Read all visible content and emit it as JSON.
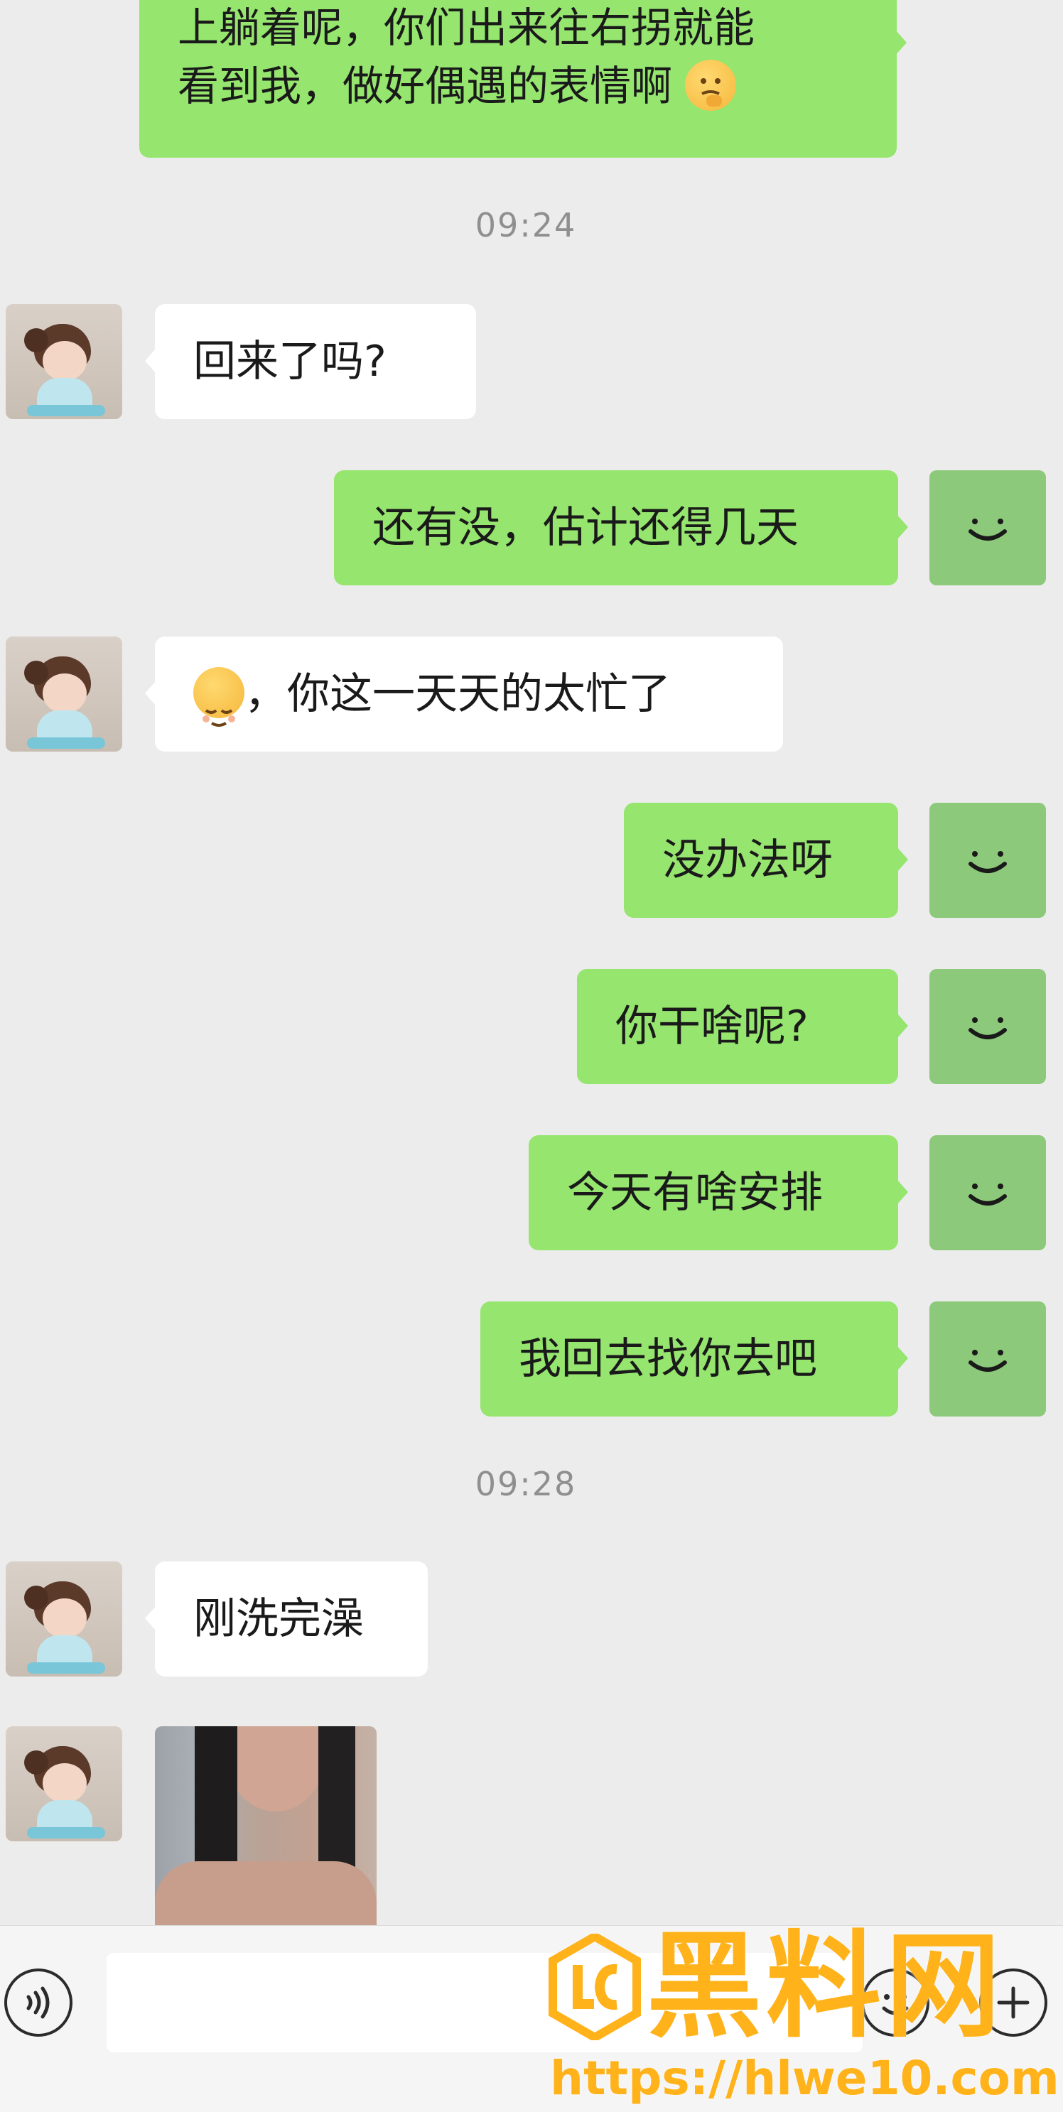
{
  "colors": {
    "background": "#ececec",
    "incoming_bubble": "#ffffff",
    "outgoing_bubble": "#95e56f",
    "timestamp": "#8f8f8f",
    "watermark": "#ffb21a"
  },
  "messages": {
    "top_partial": {
      "line1": "上躺着呢，你们出来往右拐就能",
      "line2": "看到我，做好偶遇的表情啊",
      "emoji": "thinking-face-emoji"
    },
    "time1": "09:24",
    "m1": "回来了吗?",
    "m2": "还有没，估计还得几天",
    "m3": "，你这一天天的太忙了",
    "m3_emoji": "relieved-face-emoji",
    "m4": "没办法呀",
    "m5": "你干啥呢?",
    "m6": "今天有啥安排",
    "m7": "我回去找你去吧",
    "time2": "09:28",
    "m8": "刚洗完澡",
    "m9_image": "photo-message"
  },
  "inputbar": {
    "voice_icon": "voice-icon",
    "emoji_icon": "emoji-icon",
    "plus_icon": "plus-icon"
  },
  "watermark": {
    "title": "黑料网",
    "url": "https://hlwe10.com"
  }
}
